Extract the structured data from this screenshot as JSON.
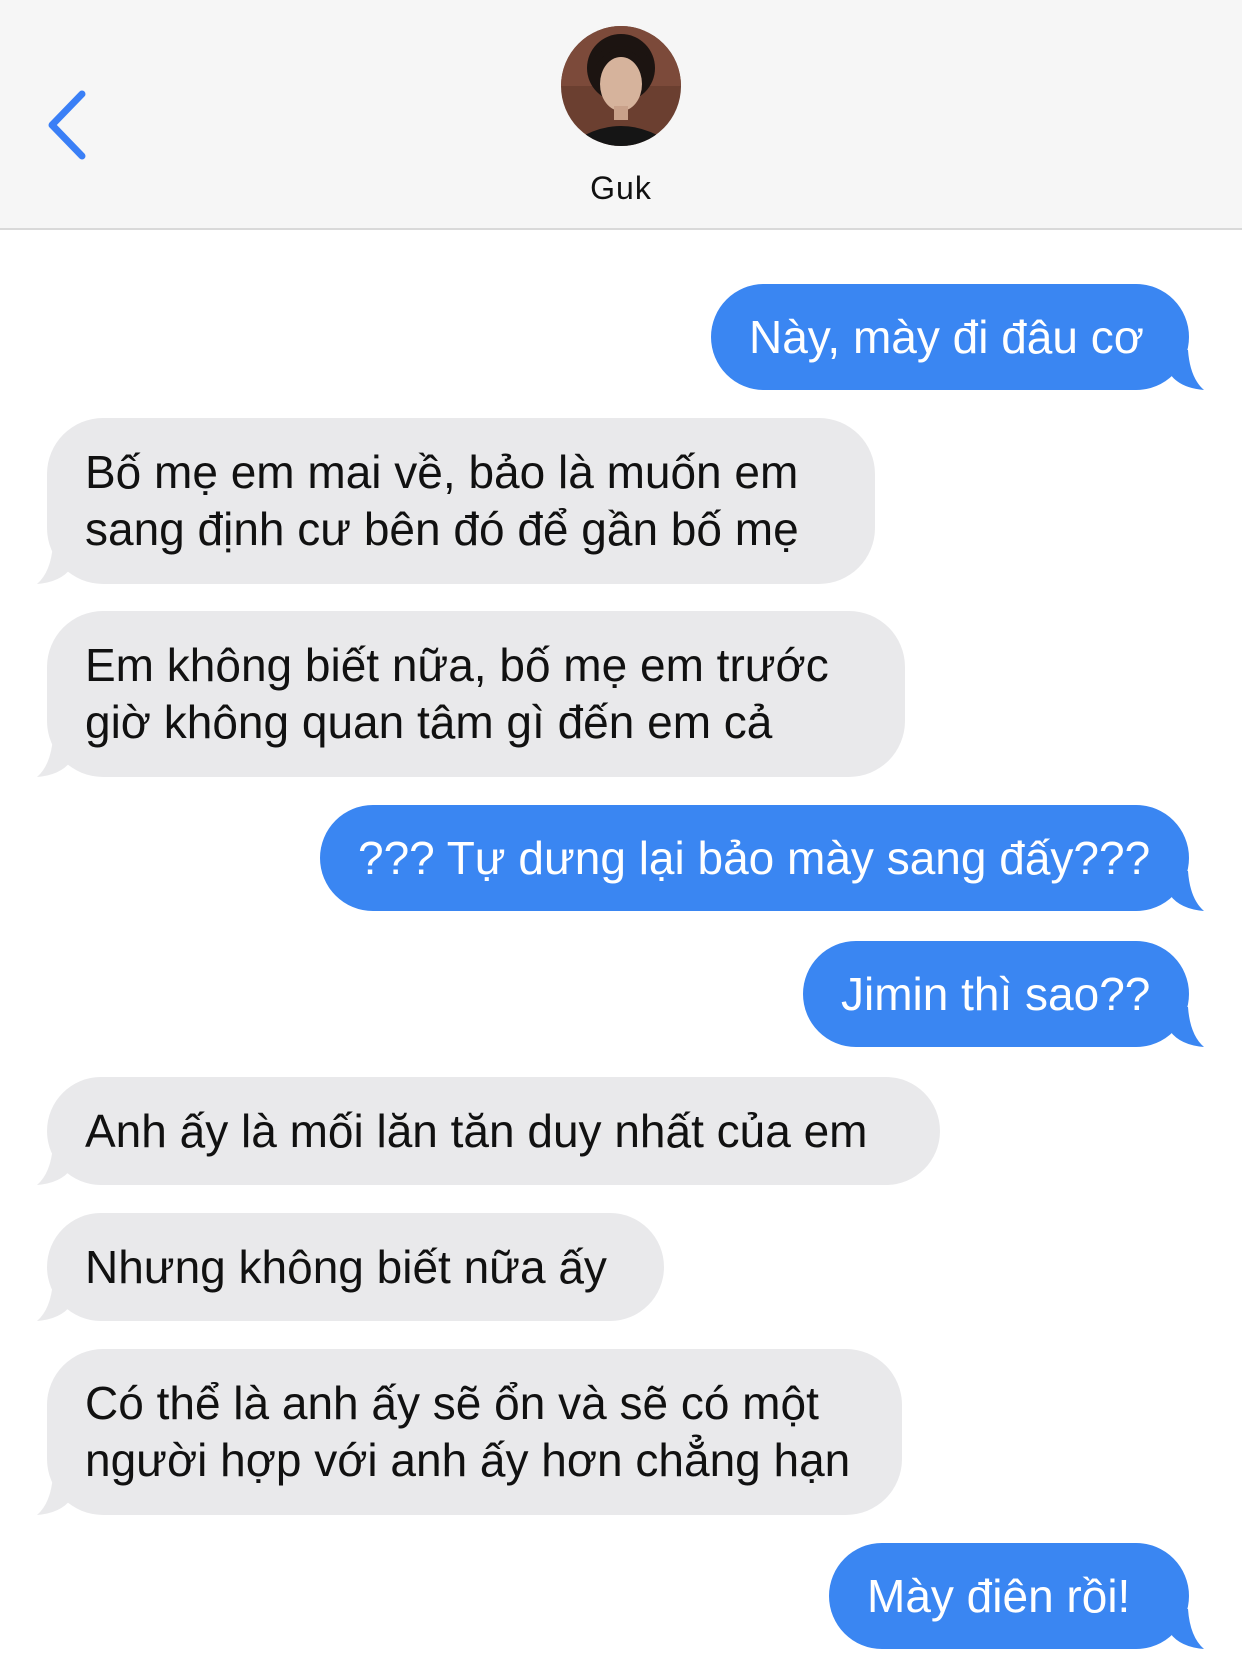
{
  "header": {
    "contact_name": "Guk",
    "back_icon": "chevron-left-icon",
    "avatar_icon": "contact-avatar"
  },
  "colors": {
    "outgoing_bubble": "#3a86f2",
    "incoming_bubble": "#e9e9eb",
    "accent": "#3a7ff6",
    "header_bg": "#f6f6f6"
  },
  "messages": [
    {
      "direction": "outgoing",
      "lines": [
        "Này, mày đi đâu cơ"
      ]
    },
    {
      "direction": "incoming",
      "lines": [
        "Bố mẹ em mai về, bảo là muốn em",
        "sang định cư bên đó để gần bố mẹ"
      ]
    },
    {
      "direction": "incoming",
      "lines": [
        "Em không biết nữa, bố mẹ em trước",
        "giờ không quan tâm gì đến em cả"
      ]
    },
    {
      "direction": "outgoing",
      "lines": [
        "??? Tự dưng lại bảo mày sang đấy???"
      ]
    },
    {
      "direction": "outgoing",
      "lines": [
        "Jimin thì sao??"
      ]
    },
    {
      "direction": "incoming",
      "lines": [
        "Anh ấy là mối lăn tăn duy nhất của em"
      ]
    },
    {
      "direction": "incoming",
      "lines": [
        "Nhưng không biết nữa ấy"
      ]
    },
    {
      "direction": "incoming",
      "lines": [
        "Có thể là anh ấy sẽ ổn và sẽ có một",
        "người hợp với anh ấy hơn chẳng hạn"
      ]
    },
    {
      "direction": "outgoing",
      "lines": [
        "Mày điên rồi!"
      ]
    }
  ]
}
